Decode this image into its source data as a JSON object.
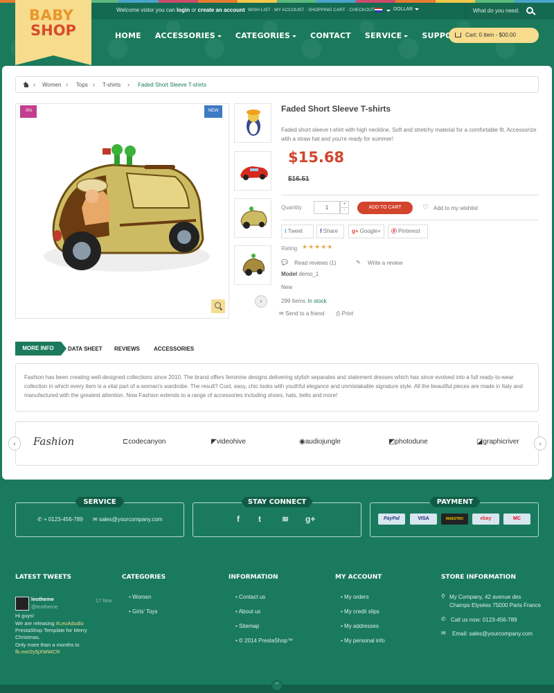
{
  "header": {
    "logo_top": "BABY",
    "logo_bottom": "SHOP",
    "welcome_prefix": "Welcome vistor you can ",
    "login": "login",
    "welcome_or": " or ",
    "create_account": "create an account",
    "top_links": "WISH LIST · MY ACCOUNT · SHOPPING CART · CHECKOUT",
    "currency": "DOLLAR",
    "search_placeholder": "What do you need.",
    "nav": [
      "HOME",
      "ACCESSORIES",
      "CATEGORIES",
      "CONTACT",
      "SERVICE",
      "SUPPORT"
    ],
    "cart": "Cart: 0 item - $00.00"
  },
  "breadcrumb": [
    "Women",
    "Tops",
    "T-shirts",
    "Faded Short Sleeve T-shirts"
  ],
  "product": {
    "badge_sale": "-5%",
    "badge_new": "NEW",
    "title": "Faded Short Sleeve T-shirts",
    "description": "Faded short sleeve t-shirt with high neckline. Soft and stretchy material for a comfortable fit. Accessorize with a straw hat and you're ready for summer!",
    "price": "$15.68",
    "old_price": "$16.51",
    "quantity_label": "Quantity",
    "quantity": "1",
    "add_to_cart": "ADD TO CART",
    "wishlist": "Add to my wishlist",
    "share": [
      "Tweet",
      "Share",
      "Google+",
      "Pinterest"
    ],
    "rating_label": "Rating",
    "rating_stars": "★★★★★",
    "read_reviews": "Read reviews (1)",
    "write_review": "Write a review",
    "model_label": "Model",
    "model_value": "demo_1",
    "condition": "New",
    "stock_count": "299 Items",
    "stock_status": "In stock",
    "send_friend": "Send to a friend",
    "print": "Print"
  },
  "tabs": [
    "MORE INFO",
    "DATA SHEET",
    "REVIEWS",
    "ACCESSORIES"
  ],
  "more_info": "Fashion has been creating well-designed collections since 2010. The brand offers feminine designs delivering stylish separates and statement dresses which has since evolved into a full ready-to-wear collection in which every item is a vital part of a woman's wardrobe. The result? Cool, easy, chic looks with youthful elegance and unmistakable signature style. All the beautiful pieces are made in Italy and manufactured with the greatest attention. Now Fashion extends to a range of accessories including shoes, hats, belts and more!",
  "brands": [
    "Fashion",
    "codecanyon",
    "videohive",
    "audiojungle",
    "photodune",
    "graphicriver"
  ],
  "footer": {
    "service_title": "SERVICE",
    "phone": "+ 0123-456-789",
    "email": "sales@yourcompany.com",
    "stay_title": "STAY CONNECT",
    "payment_title": "PAYMENT",
    "payments": [
      "PayPal",
      "VISA",
      "MAESTRO",
      "ebay",
      "MC"
    ],
    "col_titles": [
      "LATEST TWEETS",
      "CATEGORIES",
      "INFORMATION",
      "MY ACCOUNT",
      "STORE INFORMATION"
    ],
    "categories": [
      "Women",
      "Girls' Toys"
    ],
    "information": [
      "Contact us",
      "About us",
      "Sitemap",
      "© 2014 PrestaShop™"
    ],
    "account": [
      "My orders",
      "My credit slips",
      "My addresses",
      "My personal info"
    ],
    "tweet_user": "leotheme",
    "tweet_handle": "@leotheme",
    "tweet_date": "17 Nov",
    "tweet_lines": [
      "Hi guys!",
      "We are releasing ",
      "PrestaShop Template for Merry",
      "Christmas.",
      " Only more than a months to"
    ],
    "tweet_tag": "#LeoAdudio",
    "tweet_link": "fb.me/2y5jXWWCR",
    "store_address": "My Company, 42 avenue des Champs Elysées 75000 Paris France",
    "store_phone": "Call us now: 0123-456-789",
    "store_email": "Email: sales@yourcompany.com"
  },
  "colors": {
    "green": "#1b7a5c",
    "accent": "#d2452c",
    "cream": "#f7dc8e"
  }
}
